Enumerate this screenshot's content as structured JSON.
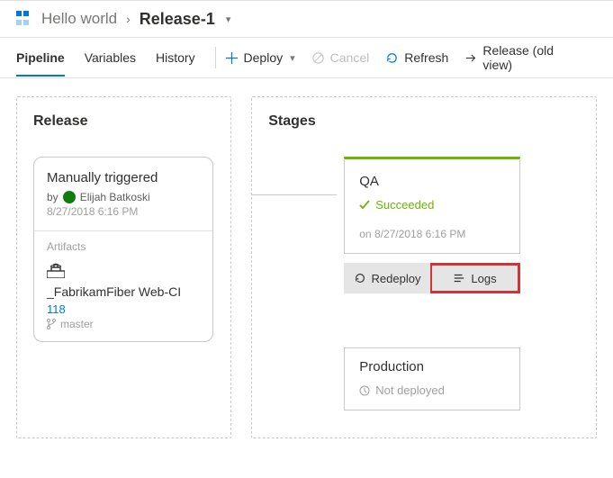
{
  "breadcrumb": {
    "root": "Hello world",
    "current": "Release-1"
  },
  "tabs": {
    "pipeline": "Pipeline",
    "variables": "Variables",
    "history": "History"
  },
  "actions": {
    "deploy": "Deploy",
    "cancel": "Cancel",
    "refresh": "Refresh",
    "release_old": "Release (old view)"
  },
  "release": {
    "panel_title": "Release",
    "trigger_title": "Manually triggered",
    "by_prefix": "by",
    "author": "Elijah Batkoski",
    "timestamp": "8/27/2018 6:16 PM",
    "artifacts_label": "Artifacts",
    "artifact_name": "_FabrikamFiber Web-CI",
    "build_number": "118",
    "branch": "master"
  },
  "stages": {
    "panel_title": "Stages",
    "qa": {
      "name": "QA",
      "status": "Succeeded",
      "ts_prefix": "on",
      "timestamp": "8/27/2018 6:16 PM"
    },
    "buttons": {
      "redeploy": "Redeploy",
      "logs": "Logs"
    },
    "prod": {
      "name": "Production",
      "status": "Not deployed"
    }
  }
}
